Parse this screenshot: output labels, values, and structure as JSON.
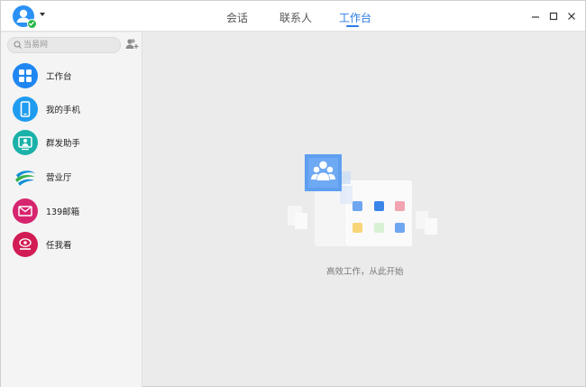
{
  "header": {
    "tabs": [
      {
        "label": "会话"
      },
      {
        "label": "联系人"
      },
      {
        "label": "工作台"
      }
    ],
    "active_tab": "工作台"
  },
  "sidebar": {
    "search": {
      "placeholder": "当易网"
    },
    "items": [
      {
        "label": "工作台",
        "icon": "grid-icon",
        "color": "#1f86f2"
      },
      {
        "label": "我的手机",
        "icon": "phone-icon",
        "color": "#1f9cf0"
      },
      {
        "label": "群发助手",
        "icon": "group-send-icon",
        "color": "#1ab1a8"
      },
      {
        "label": "营业厅",
        "icon": "china-mobile-icon",
        "color": "#0f8fd6"
      },
      {
        "label": "139邮箱",
        "icon": "mail-icon",
        "color": "#d6256e"
      },
      {
        "label": "任我看",
        "icon": "watch-icon",
        "color": "#d11c54"
      }
    ]
  },
  "main": {
    "empty_caption": "高效工作，从此开始"
  },
  "colors": {
    "accent": "#2b7be6",
    "background": "#ebebeb"
  }
}
